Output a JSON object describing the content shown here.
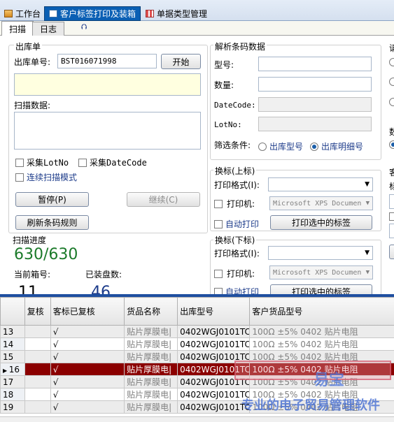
{
  "tabs": [
    {
      "label": "工作台",
      "icon": "workbench-icon"
    },
    {
      "label": "客户标签打印及装箱",
      "icon": "document-icon"
    },
    {
      "label": "单据类型管理",
      "icon": "grid-icon"
    }
  ],
  "subtabs": [
    "扫描",
    "日志"
  ],
  "outbound": {
    "group_title": "出库单",
    "order_label": "出库单号:",
    "order_value": "BST016071998",
    "start_button": "开始",
    "scan_data_label": "扫描数据:",
    "collect_lotno": "采集LotNo",
    "collect_datecode": "采集DateCode",
    "continuous_mode": "连续扫描模式",
    "pause_button": "暂停(P)",
    "continue_button": "继续(C)",
    "refresh_button": "刷新条码规则"
  },
  "progress": {
    "title": "扫描进度",
    "value": "630/630",
    "current_box_label": "当前箱号:",
    "packed_label": "已装盘数:",
    "current_box_value": "11",
    "packed_value": "46"
  },
  "parse": {
    "group_title": "解析条码数据",
    "model_label": "型号:",
    "qty_label": "数量:",
    "datecode_label": "DateCode:",
    "lotno_label": "LotNo:",
    "filter_label": "筛选条件:",
    "filter_options": [
      "出库型号",
      "出库明细号"
    ],
    "filter_selected": 1
  },
  "label_top": {
    "group_title": "换标(上标)",
    "format_label": "打印格式(I):",
    "printer_label": "打印机:",
    "printer_value": "Microsoft XPS Documen",
    "auto_print_label": "自动打印",
    "print_selected_button": "打印选中的标签"
  },
  "label_bottom": {
    "group_title": "换标(下标)",
    "format_label": "打印格式(I):",
    "printer_label": "打印机:",
    "printer_value": "Microsoft XPS Documen",
    "auto_print_label": "自动打印",
    "print_selected_button": "打印选中的标签"
  },
  "right_clip": {
    "label_a": "请",
    "label_b": "数",
    "label_c": "客",
    "label_d": "标"
  },
  "table": {
    "columns": [
      "",
      "复核",
      "客标已复核",
      "货品名称",
      "出库型号",
      "客户货品型号"
    ],
    "rows": [
      {
        "no": "13",
        "checked": "",
        "customer_checked": "√",
        "name": "贴片厚膜电|",
        "model": "0402WGJ0101TC",
        "customer_model": "100Ω ±5% 0402 贴片电阻",
        "selected": false
      },
      {
        "no": "14",
        "checked": "",
        "customer_checked": "√",
        "name": "贴片厚膜电|",
        "model": "0402WGJ0101TC",
        "customer_model": "100Ω ±5% 0402 贴片电阻",
        "selected": false
      },
      {
        "no": "15",
        "checked": "",
        "customer_checked": "√",
        "name": "贴片厚膜电|",
        "model": "0402WGJ0101TC",
        "customer_model": "100Ω ±5% 0402 贴片电阻",
        "selected": false
      },
      {
        "no": "16",
        "checked": "",
        "customer_checked": "√",
        "name": "贴片厚膜电|",
        "model": "0402WGJ0101TC",
        "customer_model": "100Ω ±5% 0402 贴片电阻",
        "selected": true
      },
      {
        "no": "17",
        "checked": "",
        "customer_checked": "√",
        "name": "贴片厚膜电|",
        "model": "0402WGJ0101TC",
        "customer_model": "100Ω ±5% 0402 贴片电阻",
        "selected": false
      },
      {
        "no": "18",
        "checked": "",
        "customer_checked": "√",
        "name": "贴片厚膜电|",
        "model": "0402WGJ0101TC",
        "customer_model": "100Ω ±5% 0402 贴片电阻",
        "selected": false
      },
      {
        "no": "19",
        "checked": "",
        "customer_checked": "√",
        "name": "贴片厚膜电|",
        "model": "0402WGJ0101TC",
        "customer_model": "100Ω ±5% 0402 贴片电阻",
        "selected": false
      }
    ]
  },
  "watermark": {
    "line1": "易宝",
    "line2": "专业的电子贸易管理软件"
  }
}
